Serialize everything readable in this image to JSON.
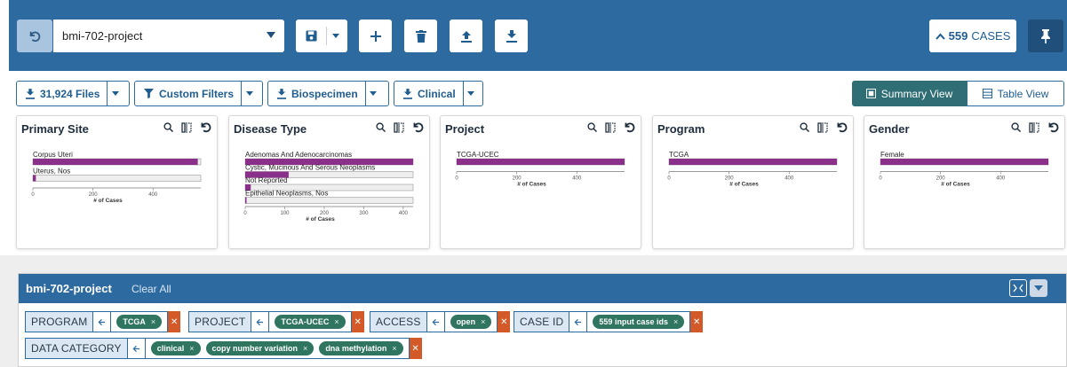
{
  "topbar": {
    "cohort_name": "bmi-702-project",
    "cases_count": "559",
    "cases_label": "CASES"
  },
  "toolbar": {
    "files_label": "31,924 Files",
    "custom_filters_label": "Custom Filters",
    "biospecimen_label": "Biospecimen",
    "clinical_label": "Clinical",
    "summary_view_label": "Summary View",
    "table_view_label": "Table View"
  },
  "cards": [
    {
      "title": "Primary Site",
      "chart_data": {
        "type": "bar",
        "categories": [
          "Corpus Uteri",
          "Uterus, Nos"
        ],
        "values": [
          549,
          10
        ],
        "xlabel": "# of Cases",
        "xticks": [
          "0",
          "200",
          "400"
        ],
        "xlim": [
          0,
          559
        ]
      }
    },
    {
      "title": "Disease Type",
      "chart_data": {
        "type": "bar",
        "categories": [
          "Adenomas And Adenocarcinomas",
          "Cystic, Mucinous And Serous Neoplasms",
          "Not Reported",
          "Epithelial Neoplasms, Nos"
        ],
        "values": [
          425,
          110,
          14,
          3
        ],
        "xlabel": "# of Cases",
        "xticks": [
          "0",
          "100",
          "200",
          "300",
          "400"
        ],
        "xlim": [
          0,
          425
        ]
      }
    },
    {
      "title": "Project",
      "chart_data": {
        "type": "bar",
        "categories": [
          "TCGA-UCEC"
        ],
        "values": [
          559
        ],
        "xlabel": "# of Cases",
        "xticks": [
          "0",
          "200",
          "400"
        ],
        "xlim": [
          0,
          559
        ]
      }
    },
    {
      "title": "Program",
      "chart_data": {
        "type": "bar",
        "categories": [
          "TCGA"
        ],
        "values": [
          559
        ],
        "xlabel": "# of Cases",
        "xticks": [
          "0",
          "200",
          "400"
        ],
        "xlim": [
          0,
          559
        ]
      }
    },
    {
      "title": "Gender",
      "chart_data": {
        "type": "bar",
        "categories": [
          "Female"
        ],
        "values": [
          559
        ],
        "xlabel": "# of Cases",
        "xticks": [
          "0",
          "200",
          "400"
        ],
        "xlim": [
          0,
          559
        ]
      }
    }
  ],
  "filters": {
    "title": "bmi-702-project",
    "clear_all": "Clear All",
    "groups": [
      {
        "label": "PROGRAM",
        "values": [
          "TCGA"
        ]
      },
      {
        "label": "PROJECT",
        "values": [
          "TCGA-UCEC"
        ]
      },
      {
        "label": "ACCESS",
        "values": [
          "open"
        ]
      },
      {
        "label": "CASE ID",
        "values": [
          "559 input case ids"
        ]
      },
      {
        "label": "DATA CATEGORY",
        "values": [
          "clinical",
          "copy number variation",
          "dna methylation"
        ]
      }
    ]
  },
  "colors": {
    "header_blue": "#2d6a9f",
    "bar_purple": "#8a2f8a",
    "pill_green": "#2f7560",
    "remove_orange": "#d35a28"
  }
}
